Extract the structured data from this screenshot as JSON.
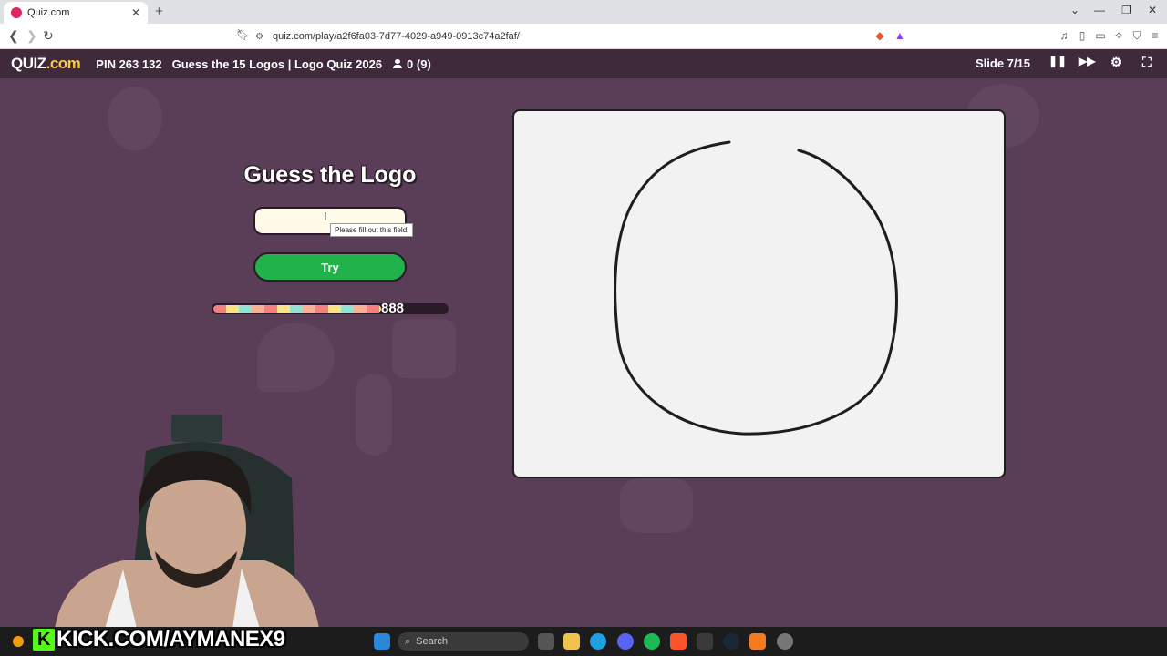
{
  "browser": {
    "tab_title": "Quiz.com",
    "url": "quiz.com/play/a2f6fa03-7d77-4029-a949-0913c74a2faf/"
  },
  "header": {
    "logo_main": "QUIZ",
    "logo_suffix": ".com",
    "pin": "PIN 263 132",
    "quiz_title": "Guess the 15 Logos | Logo Quiz 2026",
    "players": "0 (9)",
    "slide": "Slide 7/15"
  },
  "question": {
    "title": "Guess the Logo",
    "input_value": "",
    "tooltip": "Please fill out this field.",
    "try_label": "Try",
    "timer_value": "888",
    "timer_fraction": 0.72
  },
  "canvas": {
    "stroke_color": "#1e1e1e",
    "background": "#f2f2f2"
  },
  "stream": {
    "banner_text": "KICK.COM/AYMANEX9"
  },
  "taskbar": {
    "search_placeholder": "Search"
  },
  "colors": {
    "page_bg": "#5a3d56",
    "header_bg": "#3f2a3c",
    "try_green": "#21b24b",
    "kick_green": "#53fc18"
  }
}
